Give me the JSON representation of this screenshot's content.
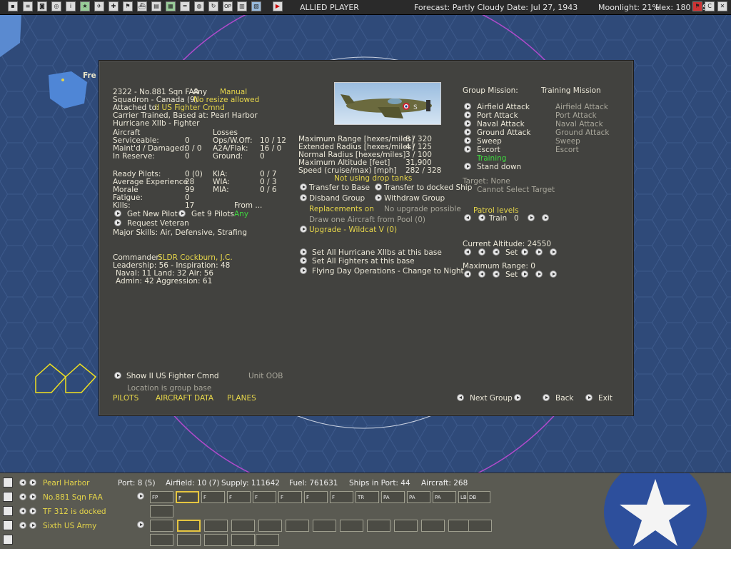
{
  "topbar": {
    "side": "ALLIED PLAYER",
    "forecast": "Forecast: Partly Cloudy",
    "date": "Date: Jul 27, 1943",
    "moonlight": "Moonlight: 21%",
    "hex": "Hex: 180 107",
    "hex_terrain": "Sh",
    "icons": [
      "square-icon",
      "doc-icon",
      "disk-icon",
      "target-icon",
      "info-icon",
      "star-icon",
      "plane-icon",
      "cross-icon",
      "flag-icon",
      "ship-icon",
      "factory-icon",
      "chart-icon",
      "road-icon",
      "globe-icon",
      "refresh-icon",
      "op-icon",
      "grid-icon",
      "sheet-icon",
      "end-turn-icon"
    ],
    "right_icons": [
      "flag-small-icon",
      "c-icon",
      "close-icon"
    ]
  },
  "map": {
    "label": "Fre"
  },
  "unit": {
    "line1": "2322 - No.881 Sqn FAA",
    "any": "Any",
    "manual": "Manual",
    "line2": "Squadron - Canada (9)",
    "no_resize": "No resize allowed",
    "attached_label": "Attached to:",
    "attached_value": "II US Fighter Cmnd",
    "line4": "Carrier Trained, Based at:  Pearl Harbor",
    "line5": "Hurricane XIIb - Fighter"
  },
  "aircraft": {
    "header": "Aircraft",
    "rows": [
      {
        "label": "Serviceable:",
        "value": "0"
      },
      {
        "label": "Maint'd / Damaged:",
        "value": "0 / 0"
      },
      {
        "label": "In Reserve:",
        "value": "0"
      }
    ]
  },
  "losses": {
    "header": "Losses",
    "rows": [
      {
        "label": "Ops/W.Off:",
        "value": "10 / 12"
      },
      {
        "label": "A2A/Flak:",
        "value": "16 / 0"
      },
      {
        "label": "Ground:",
        "value": "0"
      }
    ]
  },
  "pilots": {
    "rows": [
      {
        "label": "Ready Pilots:",
        "value": "0 (0)"
      },
      {
        "label": "Average Experience",
        "value": "28"
      },
      {
        "label": "Morale",
        "value": "99"
      },
      {
        "label": "Fatigue:",
        "value": "0"
      },
      {
        "label": "Kills:",
        "value": "17"
      }
    ],
    "casualties": [
      {
        "label": "KIA:",
        "value": "0 / 7"
      },
      {
        "label": "WIA:",
        "value": "0 / 3"
      },
      {
        "label": "MIA:",
        "value": "0 / 6"
      }
    ],
    "from_label": "From ...",
    "from_value": "Any",
    "get_new_pilot": "Get New Pilot",
    "get_9_pilots": "Get 9 Pilots",
    "request_veteran": "Request Veteran",
    "major_skills": "Major Skills: Air, Defensive, Strafing"
  },
  "commander": {
    "label": "Commander:",
    "name": "SLDR Cockburn, J.C.",
    "line2": "Leadership: 56 - Inspiration: 48",
    "line3": "Naval: 11   Land: 32   Air: 56",
    "line4": "Admin: 42   Aggression: 61"
  },
  "specs": {
    "rows": [
      {
        "label": "Maximum Range [hexes/miles]",
        "value": "8 / 320"
      },
      {
        "label": "Extended Radius [hexes/miles]",
        "value": "4 / 125"
      },
      {
        "label": "Normal Radius [hexes/miles]",
        "value": "3 / 100"
      },
      {
        "label": "Maximum Altitude [feet]",
        "value": "31,900"
      },
      {
        "label": "Speed (cruise/max) [mph]",
        "value": "282 / 328"
      }
    ],
    "drop_tanks": "Not using drop tanks"
  },
  "actions": {
    "transfer_base": "Transfer to Base",
    "transfer_ship": "Transfer to docked Ship",
    "disband": "Disband Group",
    "withdraw": "Withdraw Group",
    "replacements": "Replacements on",
    "no_upgrade": "No upgrade possible",
    "draw_one": "Draw one Aircraft from Pool (0)",
    "upgrade": "Upgrade - Wildcat V  (0)",
    "set_all_hurricane": "Set All Hurricane XIIbs at this base",
    "set_all_fighters": "Set All Fighters at this base",
    "flying_day": "Flying Day Operations - Change to Night"
  },
  "missions": {
    "group_header": "Group Mission:",
    "training_header": "Training Mission",
    "group": [
      "Airfield Attack",
      "Port Attack",
      "Naval Attack",
      "Ground Attack",
      "Sweep",
      "Escort",
      "Training",
      "Stand down"
    ],
    "training": [
      "Airfield Attack",
      "Port Attack",
      "Naval Attack",
      "Ground Attack",
      "Sweep",
      "Escort"
    ],
    "target": "Target: None",
    "cannot_select": "Cannot Select Target",
    "patrol_header": "Patrol levels",
    "train_label": "Train",
    "train_value": "0",
    "altitude": "Current Altitude: 24550",
    "set_label": "Set",
    "max_range": "Maximum Range: 0",
    "set_label2": "Set"
  },
  "footer": {
    "show_hq": "Show II US Fighter Cmnd",
    "unit_oob": "Unit OOB",
    "location": "Location is group base",
    "tabs": [
      "PILOTS",
      "AIRCRAFT DATA",
      "PLANES"
    ],
    "next_group": "Next Group",
    "back": "Back",
    "exit": "Exit"
  },
  "bottom": {
    "base": "Pearl Harbor",
    "squadron": "No.881 Sqn FAA",
    "tf": "TF 312 is docked",
    "army": "Sixth US Army",
    "port": "Port: 8 (5)",
    "airfield": "Airfield: 10 (7)",
    "supply": "Supply: 111642",
    "fuel": "Fuel: 761631",
    "ships": "Ships in Port: 44",
    "aircraft": "Aircraft: 268",
    "air_slots": [
      "FP",
      "F",
      "F",
      "F",
      "F",
      "F",
      "F",
      "F",
      "TR",
      "PA",
      "PA",
      "PA",
      "LB",
      "DB"
    ],
    "land_slots": [
      "hq",
      "grid",
      "wave",
      "grid2",
      "flag",
      "BF",
      "x",
      "slash",
      "x2",
      "tri",
      "rr",
      "rr2",
      "rr3"
    ],
    "colors": {
      "selected_border": "#e6c640",
      "text_yellow": "#e6d64a",
      "text_green": "#3fdc3f"
    }
  }
}
